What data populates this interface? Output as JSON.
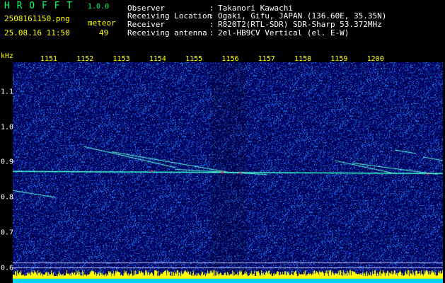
{
  "header": {
    "app_title": "H R O F F T",
    "version": "1.0.0",
    "filename": "2508161150.png",
    "datetime": "25.08.16 11:50",
    "count_label": "meteor",
    "count_value": "49"
  },
  "info": {
    "rows": [
      {
        "label": "Observer",
        "sep": ":",
        "value": "Takanori Kawachi"
      },
      {
        "label": "Receiving Location",
        "sep": ":",
        "value": "Ogaki, Gifu, JAPAN (136.60E, 35.35N)"
      },
      {
        "label": "Receiver",
        "sep": ":",
        "value": "R820T2(RTL-SDR) SDR-Sharp 53.372MHz"
      },
      {
        "label": "Receiving antenna",
        "sep": ":",
        "value": "2el-HB9CV Vertical (el. E-W)"
      }
    ]
  },
  "chart_data": {
    "type": "heatmap",
    "ylabel": "kHz",
    "x_ticks": [
      "1151",
      "1152",
      "1153",
      "1154",
      "1155",
      "1156",
      "1157",
      "1158",
      "1159",
      "1200"
    ],
    "y_ticks": [
      "1.1",
      "1.0",
      "0.9",
      "0.8",
      "0.7",
      "0.6"
    ],
    "y_range": [
      0.6,
      1.2
    ],
    "colors": {
      "background": "#000060",
      "noise": "#3060ff",
      "signal": "#40ffd0",
      "peak": "#ff3060",
      "bars": "#ffff00",
      "baseline": "#00d0ff"
    }
  }
}
